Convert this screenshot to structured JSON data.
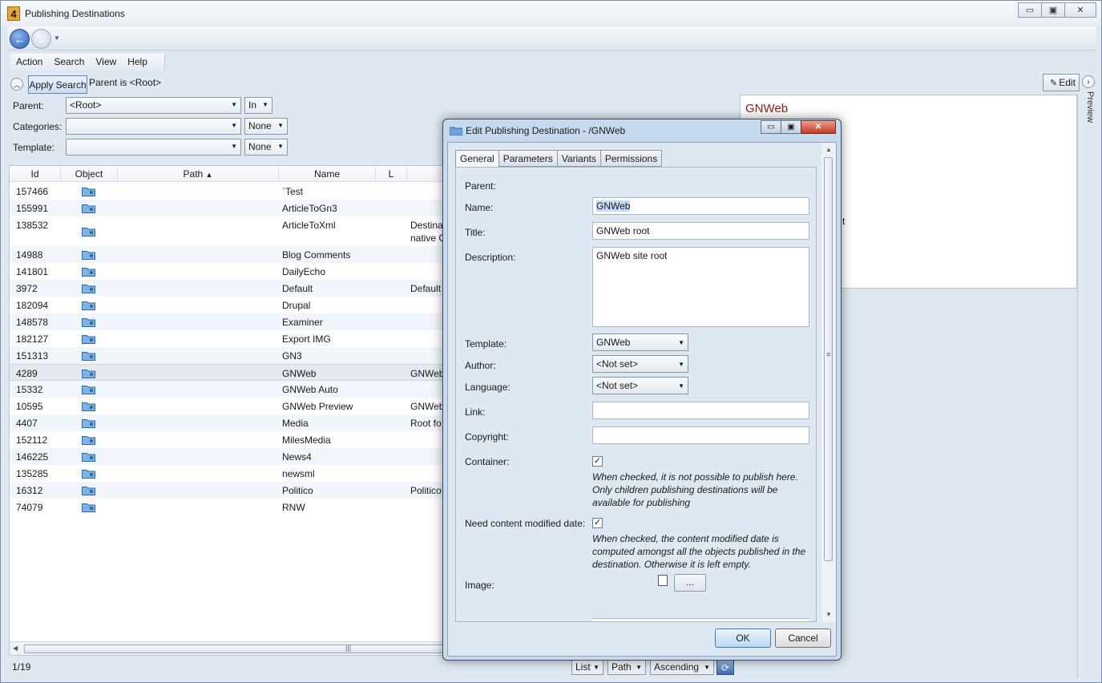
{
  "window": {
    "title": "Publishing Destinations",
    "app_icon": "4"
  },
  "menu": [
    "Action",
    "Search",
    "View",
    "Help"
  ],
  "search": {
    "apply_label": "Apply Search",
    "summary": "Parent is <Root>",
    "parent_label": "Parent:",
    "parent_value": "<Root>",
    "parent_mode": "In",
    "categories_label": "Categories:",
    "categories_value": "",
    "categories_mode": "None",
    "template_label": "Template:",
    "template_value": "",
    "template_mode": "None"
  },
  "grid": {
    "columns": [
      "Id",
      "Object",
      "Path",
      "Name",
      "L"
    ],
    "rows": [
      {
        "id": "157466",
        "name": "`Test",
        "extra": ""
      },
      {
        "id": "155991",
        "name": "ArticleToGn3",
        "extra": ""
      },
      {
        "id": "138532",
        "name": "ArticleToXml",
        "extra": "Destina",
        "extra2": "native C"
      },
      {
        "id": "14988",
        "name": "Blog Comments",
        "extra": ""
      },
      {
        "id": "141801",
        "name": "DailyEcho",
        "extra": ""
      },
      {
        "id": "3972",
        "name": "Default",
        "extra": "Default"
      },
      {
        "id": "182094",
        "name": "Drupal",
        "extra": ""
      },
      {
        "id": "148578",
        "name": "Examiner",
        "extra": ""
      },
      {
        "id": "182127",
        "name": "Export IMG",
        "extra": ""
      },
      {
        "id": "151313",
        "name": "GN3",
        "extra": ""
      },
      {
        "id": "4289",
        "name": "GNWeb",
        "extra": "GNWeb"
      },
      {
        "id": "15332",
        "name": "GNWeb Auto",
        "extra": ""
      },
      {
        "id": "10595",
        "name": "GNWeb Preview",
        "extra": "GNWeb"
      },
      {
        "id": "4407",
        "name": "Media",
        "extra": "Root fo"
      },
      {
        "id": "152112",
        "name": "MilesMedia",
        "extra": ""
      },
      {
        "id": "146225",
        "name": "News4",
        "extra": ""
      },
      {
        "id": "135285",
        "name": "newsml",
        "extra": ""
      },
      {
        "id": "16312",
        "name": "Politico",
        "extra": "Politico"
      },
      {
        "id": "74079",
        "name": "RNW",
        "extra": ""
      }
    ]
  },
  "status": {
    "count": "1/19",
    "view_mode": "List",
    "sort_field": "Path",
    "sort_order": "Ascending"
  },
  "preview": {
    "edit_label": "Edit",
    "title": "GNWeb",
    "tab_label": "Preview",
    "stray_char": "t"
  },
  "dialog": {
    "title": "Edit Publishing Destination - /GNWeb",
    "tabs": [
      "General",
      "Parameters",
      "Variants",
      "Permissions"
    ],
    "parent_label": "Parent:",
    "name_label": "Name:",
    "name_value": "GNWeb",
    "title_label": "Title:",
    "title_value": "GNWeb root",
    "description_label": "Description:",
    "description_value": "GNWeb site root",
    "template_label": "Template:",
    "template_value": "GNWeb",
    "author_label": "Author:",
    "author_value": "<Not set>",
    "language_label": "Language:",
    "language_value": "<Not set>",
    "link_label": "Link:",
    "copyright_label": "Copyright:",
    "container_label": "Container:",
    "container_hint": "When checked, it is not possible to publish here. Only children publishing destinations will be available for publishing",
    "need_date_label": "Need content modified date:",
    "need_date_hint": "When checked, the content modified date is computed amongst all the objects published in the destination. Otherwise it is left empty.",
    "image_label": "Image:",
    "image_button": "...",
    "ok_label": "OK",
    "cancel_label": "Cancel"
  }
}
